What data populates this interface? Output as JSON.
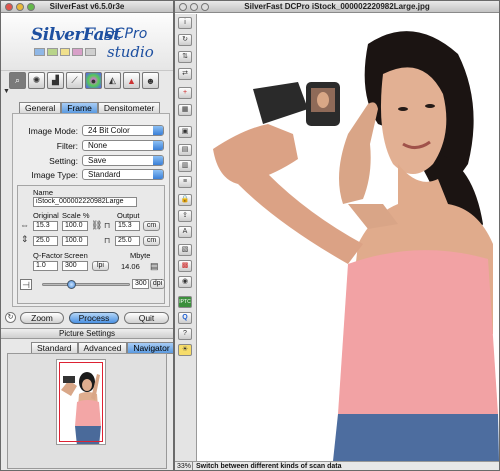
{
  "left_window": {
    "title": "SilverFast v6.5.0r3e",
    "logo": {
      "brand": "SilverFast",
      "edition": "DCPro",
      "subtitle": "studio"
    },
    "toolbar_icons": [
      "magnifier-icon",
      "color-wheel-icon",
      "histogram-icon",
      "gradation-curve-icon",
      "color-correction-icon",
      "selective-color-icon",
      "negafix-icon",
      "expert-icon"
    ],
    "tabs": [
      "General",
      "Frame",
      "Densitometer"
    ],
    "active_tab": "Frame",
    "settings": {
      "image_mode_label": "Image Mode:",
      "image_mode_value": "24 Bit Color",
      "filter_label": "Filter:",
      "filter_value": "None",
      "setting_label": "Setting:",
      "setting_value": "Save",
      "image_type_label": "Image Type:",
      "image_type_value": "Standard"
    },
    "frame": {
      "name_label": "Name",
      "name_value": "iStock_000002220982Large",
      "original_label": "Original",
      "scale_label": "Scale %",
      "output_label": "Output",
      "width_original": "15.3",
      "width_scale": "100.0",
      "width_output": "15.3",
      "width_unit": "cm",
      "height_original": "25.0",
      "height_scale": "100.0",
      "height_output": "25.0",
      "height_unit": "cm",
      "qfactor_label": "Q-Factor",
      "screen_label": "Screen",
      "mbyte_label": "Mbyte",
      "qfactor_value": "1.0",
      "screen_value": "300",
      "screen_unit": "lpi",
      "mbyte_value": "14.06",
      "resolution_value": "300",
      "resolution_unit": "dpi"
    },
    "buttons": {
      "zoom": "Zoom",
      "process": "Process",
      "quit": "Quit"
    },
    "picture_settings": {
      "title": "Picture Settings",
      "tabs": [
        "Standard",
        "Advanced",
        "Navigator"
      ],
      "active_tab": "Navigator"
    }
  },
  "right_window": {
    "title": "SilverFast DCPro iStock_000002220982Large.jpg",
    "side_tools": [
      "info-icon",
      "rotate-icon",
      "flip-icon",
      "mirror-icon",
      "crosshair-icon",
      "grid-icon",
      "frame-icon",
      "document-icon",
      "pages-icon",
      "list-icon",
      "lock-icon",
      "upload-icon",
      "text-size-icon",
      "layers-icon",
      "film-icon",
      "eye-icon",
      "iptc-icon",
      "zoom-icon",
      "help-icon",
      "lightbulb-icon"
    ],
    "side_tool_labels": [
      "i",
      "↻",
      "⇅",
      "⇄",
      "+",
      "▦",
      "▣",
      "▤",
      "▥",
      "≡",
      "🔒",
      "⇪",
      "A",
      "▧",
      "▩",
      "◉",
      "IPTC",
      "Q",
      "?",
      "☀"
    ],
    "status": {
      "zoom": "33%",
      "message": "Switch between different kinds of scan data"
    }
  }
}
